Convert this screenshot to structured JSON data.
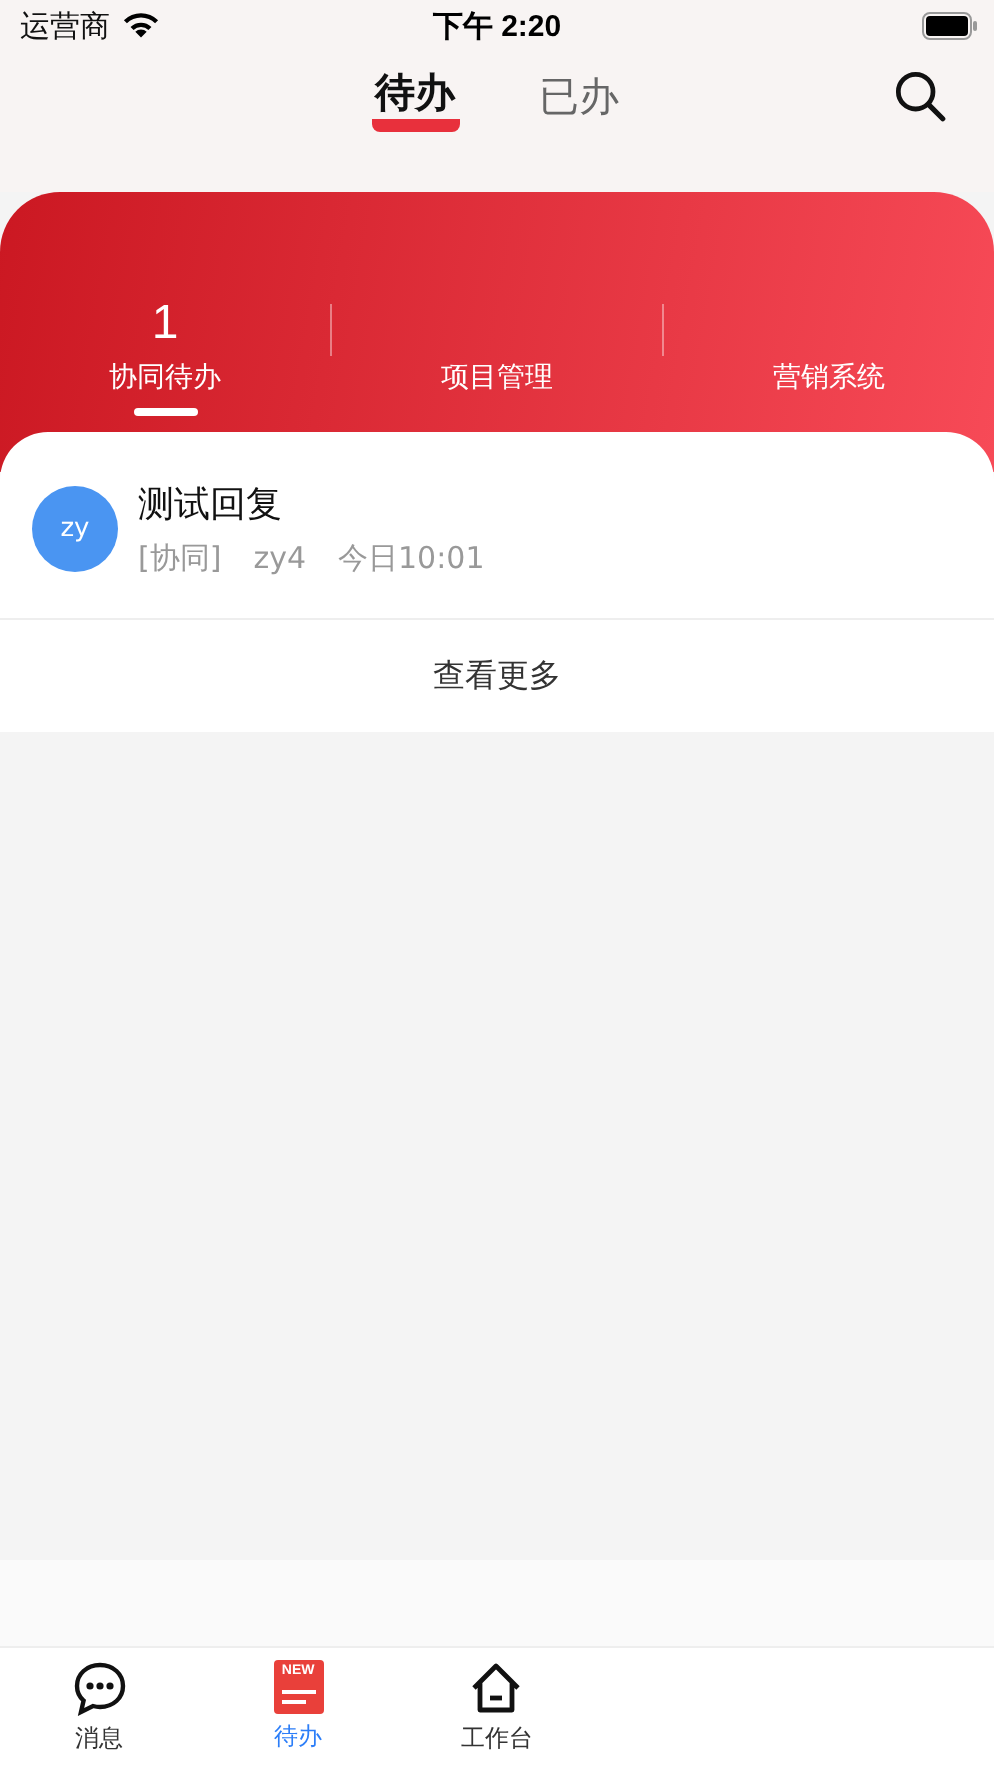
{
  "status_bar": {
    "carrier": "运营商",
    "time": "下午 2:20"
  },
  "header": {
    "tabs": [
      {
        "label": "待办",
        "selected": true
      },
      {
        "label": "已办",
        "selected": false
      }
    ]
  },
  "categories": [
    {
      "count": "1",
      "label": "协同待办",
      "selected": true
    },
    {
      "label": "项目管理",
      "selected": false
    },
    {
      "label": "营销系统",
      "selected": false
    }
  ],
  "items": [
    {
      "avatar": "zy",
      "title": "测试回复",
      "tag": "[协同]",
      "sender": "zy4",
      "time": "今日10:01"
    }
  ],
  "more": "查看更多",
  "tab_bar": [
    {
      "kind": "chat",
      "label": "消息",
      "selected": false
    },
    {
      "kind": "new",
      "icon_text": "NEW",
      "label": "待办",
      "selected": true
    },
    {
      "kind": "home",
      "label": "工作台",
      "selected": false
    }
  ]
}
